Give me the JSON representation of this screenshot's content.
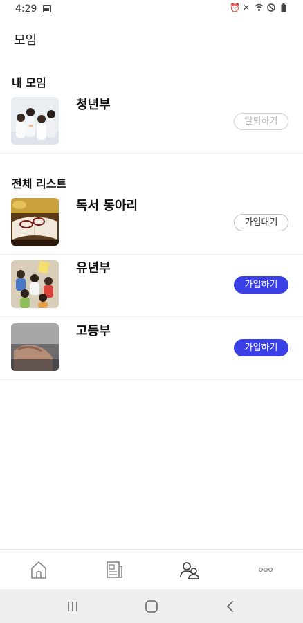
{
  "status_bar": {
    "time": "4:29"
  },
  "header": {
    "title": "모임"
  },
  "my_groups": {
    "section_title": "내 모임",
    "items": [
      {
        "name": "청년부",
        "action_label": "탈퇴하기",
        "thumb": "youth-group-photo"
      }
    ]
  },
  "all_groups": {
    "section_title": "전체 리스트",
    "items": [
      {
        "name": "독서 동아리",
        "action_label": "가입대기",
        "thumb": "book-glasses-photo"
      },
      {
        "name": "유년부",
        "action_label": "가입하기",
        "thumb": "children-group-photo"
      },
      {
        "name": "고등부",
        "action_label": "가입하기",
        "thumb": "hands-photo"
      }
    ]
  },
  "colors": {
    "accent": "#3a3fe6",
    "pending_border": "#bdbdbd",
    "leave_text": "#b8b8b8"
  },
  "bottom_nav": {
    "items": [
      {
        "icon": "home-icon"
      },
      {
        "icon": "news-icon"
      },
      {
        "icon": "group-icon",
        "active": true
      },
      {
        "icon": "more-icon"
      }
    ]
  },
  "system_nav": {
    "items": [
      "recents-icon",
      "home-circle-icon",
      "back-icon"
    ]
  }
}
